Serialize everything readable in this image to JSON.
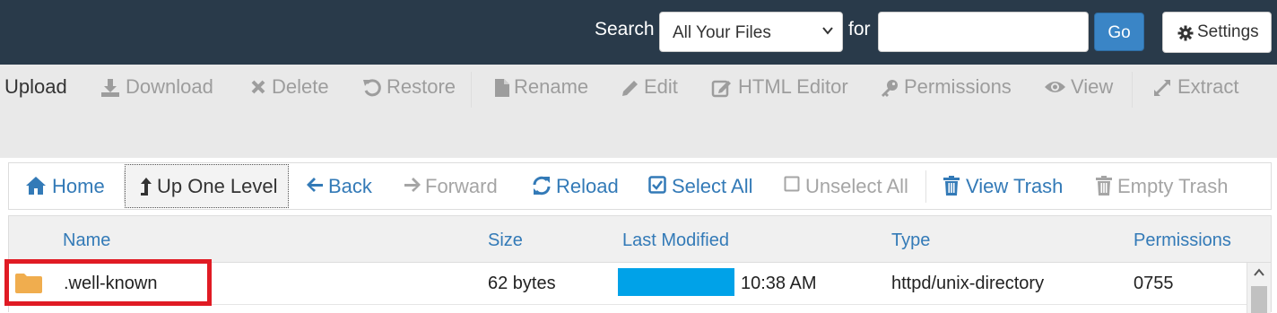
{
  "search": {
    "label": "Search",
    "scope_value": "All Your Files",
    "for_label": "for",
    "query_value": "",
    "go_label": "Go",
    "settings_label": "Settings"
  },
  "actions": [
    {
      "label": "Upload",
      "icon": "upload-icon",
      "enabled": true
    },
    {
      "label": "Download",
      "icon": "download-icon",
      "enabled": false
    },
    {
      "label": "Delete",
      "icon": "delete-icon",
      "enabled": false
    },
    {
      "label": "Restore",
      "icon": "restore-icon",
      "enabled": false
    },
    {
      "label": "Rename",
      "icon": "file-icon",
      "enabled": false
    },
    {
      "label": "Edit",
      "icon": "pencil-icon",
      "enabled": false
    },
    {
      "label": "HTML Editor",
      "icon": "edit-square-icon",
      "enabled": false
    },
    {
      "label": "Permissions",
      "icon": "key-icon",
      "enabled": false
    },
    {
      "label": "View",
      "icon": "eye-icon",
      "enabled": false
    },
    {
      "label": "Extract",
      "icon": "expand-icon",
      "enabled": false
    }
  ],
  "nav": [
    {
      "label": "Home",
      "icon": "home-icon",
      "enabled": true
    },
    {
      "label": "Up One Level",
      "icon": "level-up-icon",
      "enabled": true
    },
    {
      "label": "Back",
      "icon": "arrow-left-icon",
      "enabled": true
    },
    {
      "label": "Forward",
      "icon": "arrow-right-icon",
      "enabled": false
    },
    {
      "label": "Reload",
      "icon": "refresh-icon",
      "enabled": true
    },
    {
      "label": "Select All",
      "icon": "checkbox-checked-icon",
      "enabled": true
    },
    {
      "label": "Unselect All",
      "icon": "checkbox-empty-icon",
      "enabled": false
    },
    {
      "label": "View Trash",
      "icon": "trash-icon",
      "enabled": true
    },
    {
      "label": "Empty Trash",
      "icon": "trash-icon",
      "enabled": false
    }
  ],
  "table": {
    "columns": [
      "Name",
      "Size",
      "Last Modified",
      "Type",
      "Permissions"
    ],
    "rows": [
      {
        "name": ".well-known",
        "size": "62 bytes",
        "modified_time": "10:38 AM",
        "type": "httpd/unix-directory",
        "permissions": "0755",
        "icon": "folder-icon"
      }
    ]
  },
  "colors": {
    "topbar": "#293a4a",
    "accent": "#337ab7",
    "go_button": "#3a85c6",
    "highlight": "#e01b24",
    "redaction": "#00a2e8",
    "folder": "#f0ad4e"
  }
}
